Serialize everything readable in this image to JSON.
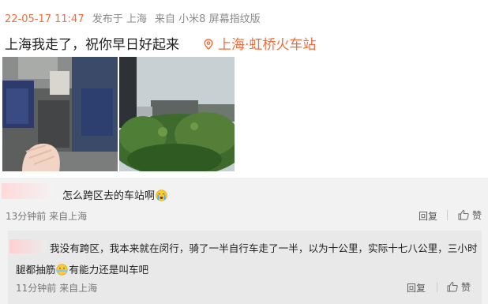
{
  "post": {
    "timestamp": "22-05-17 11:47",
    "published_in": "发布于 上海",
    "device": "来自 小米8 屏幕指纹版",
    "text": "上海我走了，祝你早日好起来",
    "location": "上海·虹桥火车站"
  },
  "comment": {
    "text": "怎么跨区去的车站啊",
    "time": "13分钟前 来自上海",
    "reply_label": "回复",
    "like_label": "赞"
  },
  "reply": {
    "text_before_emoji": "我没有跨区，我本来就在闵行，骑了一半自行车走了一半，以为十公里，实际十七八公里，三小时腿都抽筋",
    "text_after_emoji": "有能力还是叫车吧",
    "time": "11分钟前 来自上海",
    "reply_label": "回复",
    "like_label": "赞"
  },
  "colors": {
    "accent": "#f36b3a",
    "comment_bg": "#f2f2f2"
  }
}
